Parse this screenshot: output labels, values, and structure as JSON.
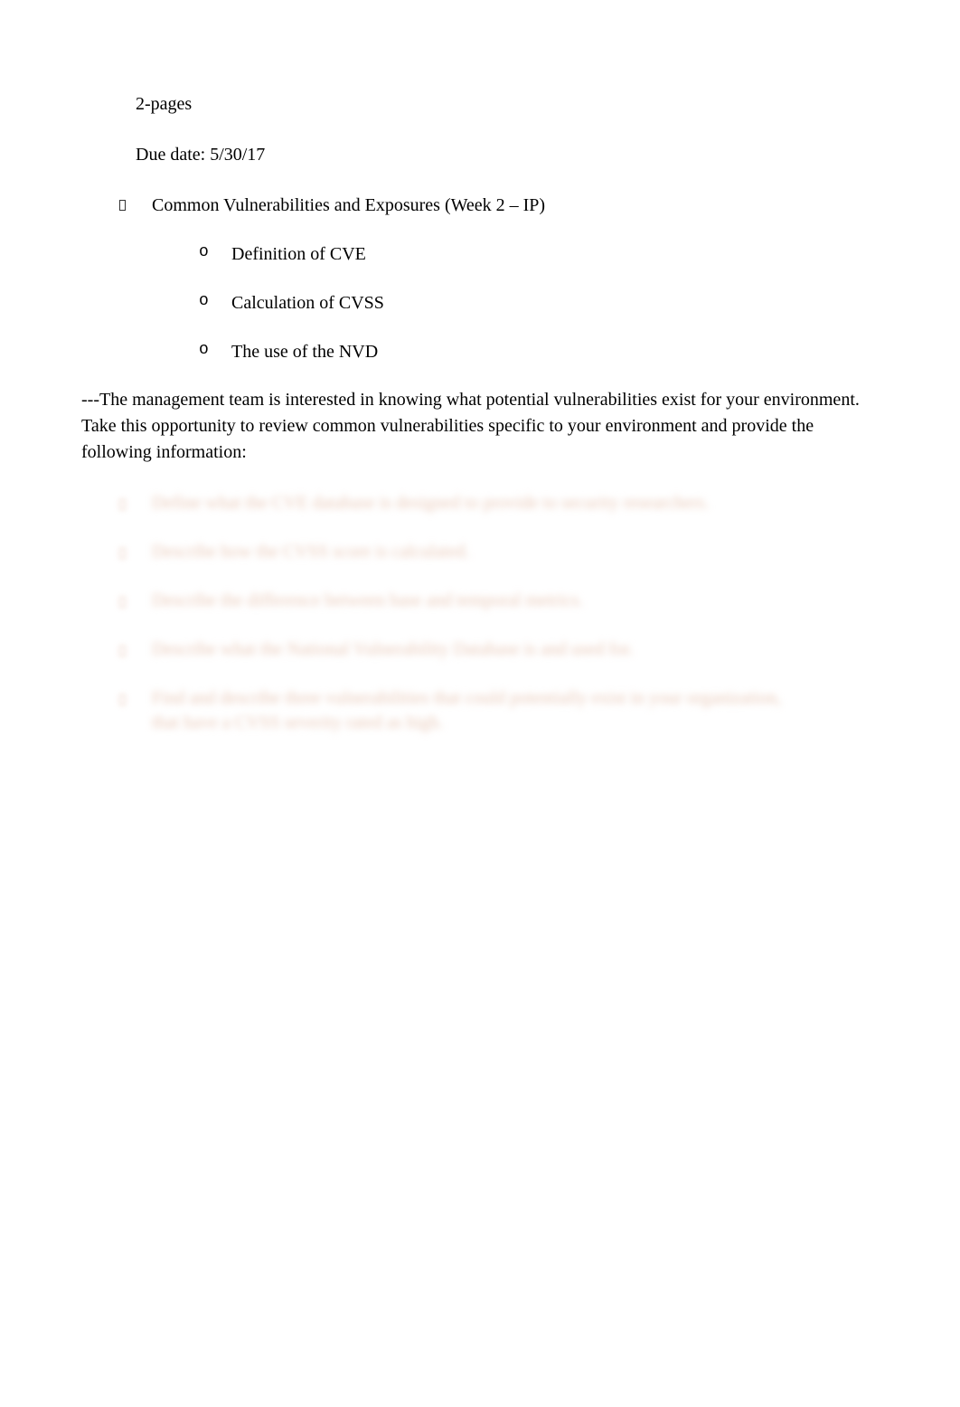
{
  "header": {
    "pages": "2-pages",
    "due_date": "Due date: 5/30/17"
  },
  "main_bullet": {
    "text": "Common Vulnerabilities and Exposures (Week 2 – IP)"
  },
  "sub_bullets": [
    {
      "text": "Definition of CVE"
    },
    {
      "text": "Calculation of CVSS"
    },
    {
      "text": "The use of the NVD"
    }
  ],
  "paragraph": "---The management team is interested in knowing what potential vulnerabilities exist for your environment. Take this opportunity to review common vulnerabilities specific to your environment and provide the following information:",
  "blurred_items": [
    {
      "line1": "Define what the CVE database is designed to provide to security researchers."
    },
    {
      "line1": "Describe how the CVSS score is calculated."
    },
    {
      "line1": "Describe the difference between base and temporal metrics."
    },
    {
      "line1": "Describe what the National Vulnerability Database is and used for."
    },
    {
      "line1": "Find and describe three vulnerabilities that could potentially exist in your organization,",
      "line2": "that have a CVSS severity rated as high."
    }
  ]
}
